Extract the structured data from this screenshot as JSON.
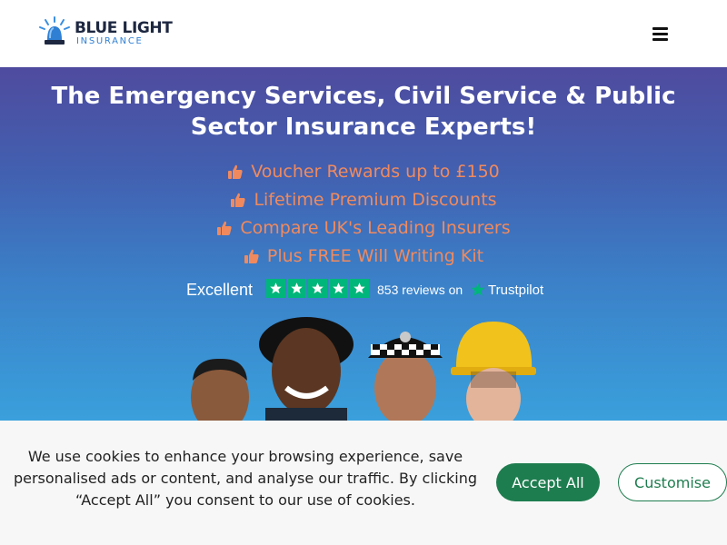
{
  "header": {
    "logo_title": "BLUE LIGHT",
    "logo_subtitle": "INSURANCE",
    "menu_icon": "hamburger-menu-icon"
  },
  "hero": {
    "title": "The Emergency Services, Civil Service & Public Sector Insurance Experts!",
    "benefit_icon": "thumbs-up-icon",
    "benefits": [
      {
        "label": "Voucher Rewards up to £150"
      },
      {
        "label": "Lifetime Premium Discounts"
      },
      {
        "label": "Compare UK's Leading Insurers"
      },
      {
        "label": "Plus FREE Will Writing Kit"
      }
    ]
  },
  "trustpilot": {
    "rating_label": "Excellent",
    "stars": 5,
    "reviews": "853 reviews on",
    "brand": "Trustpilot"
  },
  "cookie_banner": {
    "message": "We use cookies to enhance your browsing experience, save personalised ads or content, and analyse our traffic. By clicking “Accept All” you consent to our use of cookies.",
    "accept_label": "Accept All",
    "customise_label": "Customise"
  },
  "colors": {
    "accent_orange": "#f08a5e",
    "trustpilot_green": "#00b67a",
    "button_green": "#1e7d4f",
    "logo_navy": "#1d2740",
    "logo_blue": "#2f7fd4"
  }
}
